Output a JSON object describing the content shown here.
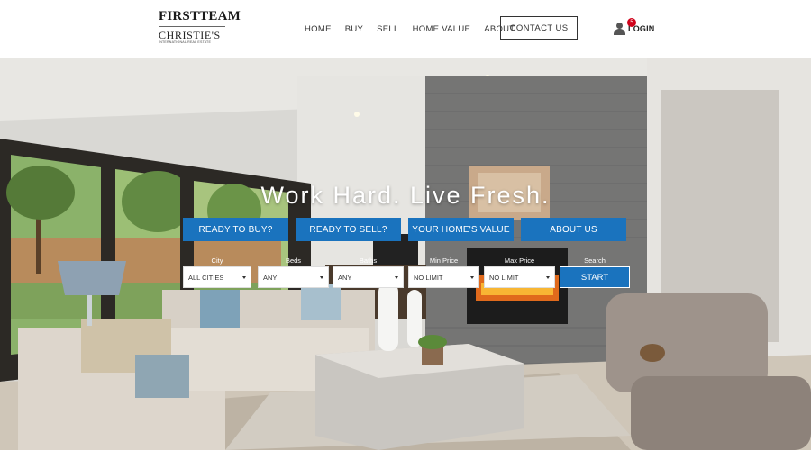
{
  "header": {
    "logo": {
      "line1": "FIRSTTEAM",
      "line2": "CHRISTIE'S",
      "line3": "INTERNATIONAL REAL ESTATE"
    },
    "nav": [
      {
        "label": "HOME"
      },
      {
        "label": "BUY"
      },
      {
        "label": "SELL"
      },
      {
        "label": "HOME VALUE"
      },
      {
        "label": "ABOUT"
      }
    ],
    "contact_label": "CONTACT US",
    "login": {
      "label": "LOGIN",
      "badge_count": "5"
    }
  },
  "hero": {
    "tagline": "Work Hard. Live Fresh.",
    "ctas": [
      {
        "label": "READY TO BUY?"
      },
      {
        "label": "READY TO SELL?"
      },
      {
        "label": "YOUR HOME'S VALUE"
      },
      {
        "label": "ABOUT US"
      }
    ],
    "search": {
      "city": {
        "label": "City",
        "value": "ALL CITIES"
      },
      "beds": {
        "label": "Beds",
        "value": "ANY"
      },
      "baths": {
        "label": "Baths",
        "value": "ANY"
      },
      "min_price": {
        "label": "Min Price",
        "value": "NO LIMIT"
      },
      "max_price": {
        "label": "Max Price",
        "value": "NO LIMIT"
      },
      "start": {
        "label": "Search",
        "button": "START"
      }
    }
  },
  "colors": {
    "accent": "#1a73be",
    "badge": "#d0021b",
    "text": "#333333"
  }
}
